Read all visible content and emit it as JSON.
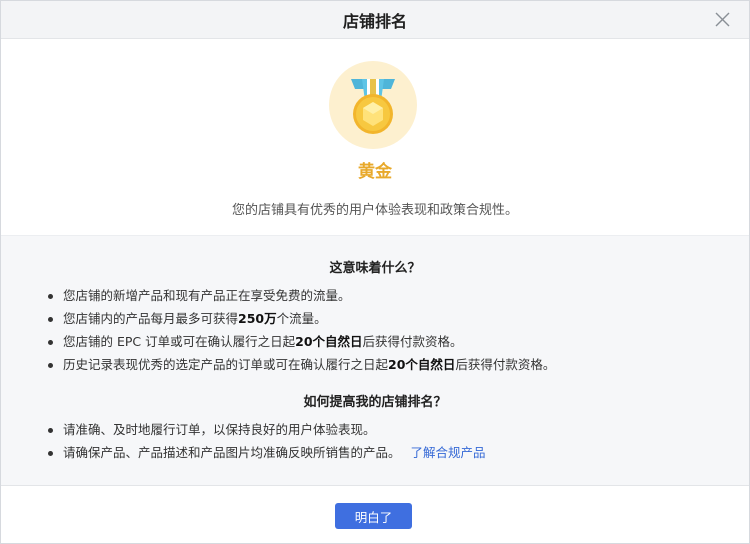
{
  "dialog": {
    "title": "店铺排名",
    "close_icon": "close-icon"
  },
  "hero": {
    "medal_icon": "gold-medal-icon",
    "tier_label": "黄金",
    "tier_color": "#e8a92b",
    "description": "您的店铺具有优秀的用户体验表现和政策合规性。"
  },
  "section_meaning": {
    "title": "这意味着什么？",
    "items": [
      {
        "parts": [
          "您店铺的新增产品和现有产品正在享受免费的流量。"
        ]
      },
      {
        "pre": "您店铺内的产品每月最多可获得",
        "bold": "250万",
        "post": "个流量。"
      },
      {
        "pre": "您店铺的 EPC 订单或可在确认履行之日起",
        "bold": "20个自然日",
        "post": "后获得付款资格。"
      },
      {
        "pre": "历史记录表现优秀的选定产品的订单或可在确认履行之日起",
        "bold": "20个自然日",
        "post": "后获得付款资格。"
      }
    ]
  },
  "section_improve": {
    "title": "如何提高我的店铺排名？",
    "item1": "请准确、及时地履行订单，以保持良好的用户体验表现。",
    "item2": "请确保产品、产品描述和产品图片均准确反映所销售的产品。",
    "item2_link": "了解合规产品"
  },
  "footer": {
    "confirm_label": "明白了",
    "accent_color": "#3f6fe0"
  }
}
